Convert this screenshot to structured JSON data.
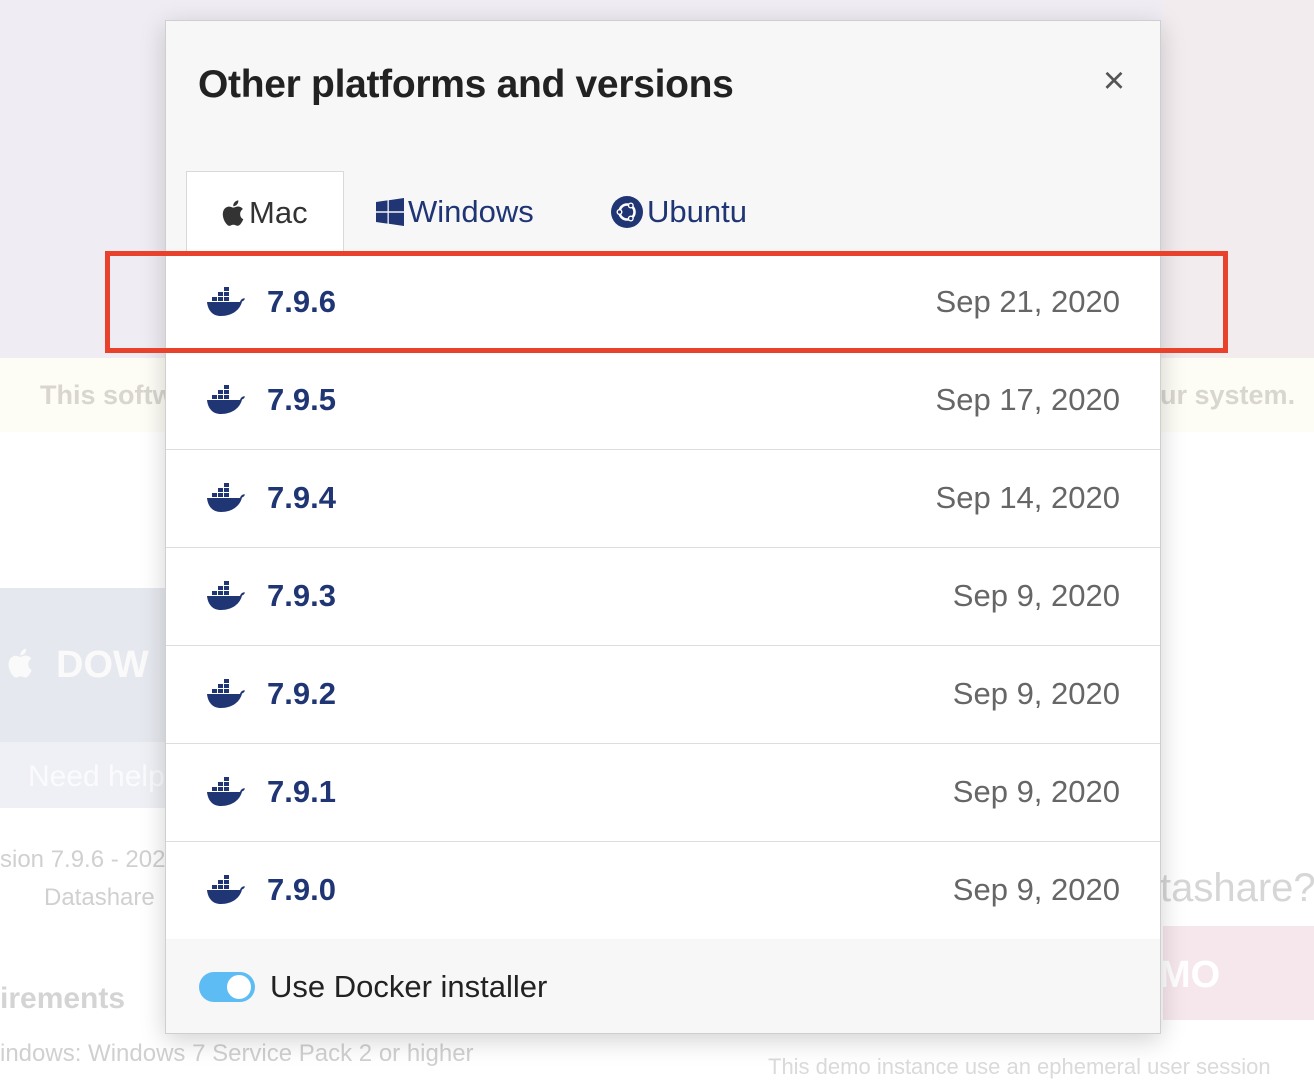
{
  "background": {
    "notice_left": "This softw",
    "notice_right": "ur system.",
    "download_label": "DOW",
    "need_help": "Need help",
    "version_line": "sion 7.9.6 - 202",
    "datashare": "Datashare",
    "requirements": "irements",
    "windows_requirement": "indows: Windows 7 Service Pack 2 or higher",
    "right_heading": "tashare?",
    "demo_label": "MO",
    "demo_note": "This demo instance use an ephemeral user session"
  },
  "modal": {
    "title": "Other platforms and versions",
    "close_symbol": "×",
    "tabs": [
      {
        "label": "Mac",
        "icon": "apple-icon"
      },
      {
        "label": "Windows",
        "icon": "windows-icon"
      },
      {
        "label": "Ubuntu",
        "icon": "ubuntu-icon"
      }
    ],
    "active_tab": "Mac",
    "versions": [
      {
        "version": "7.9.6",
        "date": "Sep 21, 2020"
      },
      {
        "version": "7.9.5",
        "date": "Sep 17, 2020"
      },
      {
        "version": "7.9.4",
        "date": "Sep 14, 2020"
      },
      {
        "version": "7.9.3",
        "date": "Sep 9, 2020"
      },
      {
        "version": "7.9.2",
        "date": "Sep 9, 2020"
      },
      {
        "version": "7.9.1",
        "date": "Sep 9, 2020"
      },
      {
        "version": "7.9.0",
        "date": "Sep 9, 2020"
      }
    ],
    "docker_toggle": {
      "label": "Use Docker installer",
      "on": true
    }
  },
  "colors": {
    "accent_blue": "#1f3574",
    "toggle_on": "#5ebcf4",
    "highlight": "#e8412c"
  }
}
